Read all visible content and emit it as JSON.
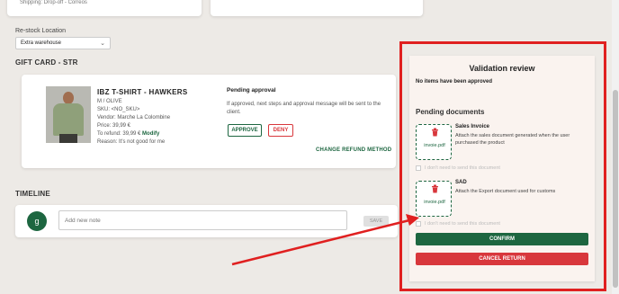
{
  "top": {
    "shipping": "Shipping: Drop-off - Correos"
  },
  "restock": {
    "label": "Re-stock Location",
    "value": "Extra warehouse"
  },
  "gift_card": {
    "title": "GIFT CARD - STR"
  },
  "product": {
    "name": "IBZ T-SHIRT - HAWKERS",
    "variant": "M / OLIVE",
    "sku": "SKU: <NO_SKU>",
    "vendor": "Vendor: Marche La Colombine",
    "price": "Price: 39,99 €",
    "refund": "To refund: 39,99 €",
    "modify": "Modify",
    "reason": "Reason: It's not good for me"
  },
  "approval": {
    "title": "Pending approval",
    "text": "If approved, next steps and approval message will be sent to the client.",
    "approve": "APPROVE",
    "deny": "DENY",
    "change_method": "CHANGE REFUND METHOD"
  },
  "timeline": {
    "title": "TIMELINE",
    "avatar": "g",
    "note_placeholder": "Add new note",
    "save": "SAVE"
  },
  "validation": {
    "title": "Validation review",
    "no_items": "No items have been approved",
    "pending_docs": "Pending documents",
    "documents": [
      {
        "name": "Sales Invoice",
        "desc": "Attach the sales document generated when the user purchased the product",
        "file": "invoie.pdf",
        "checkbox": "I don't need to send this document"
      },
      {
        "name": "SAD",
        "desc": "Attach the Export document used for customs",
        "file": "invoie.pdf",
        "checkbox": "I don't need to send this document"
      }
    ],
    "confirm": "CONFIRM",
    "cancel": "CANCEL RETURN"
  },
  "colors": {
    "accent": "#1d6640",
    "danger": "#d8373c",
    "annotation": "#e02020"
  },
  "icons": {
    "trash": "trash-icon",
    "chevron": "chevron-down-icon"
  }
}
